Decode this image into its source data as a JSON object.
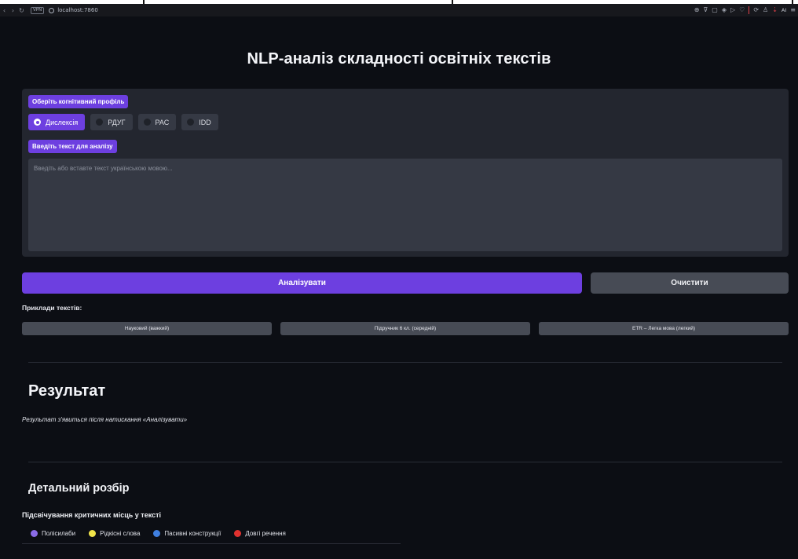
{
  "browser": {
    "url": "localhost:7860",
    "vpn_label": "VPN",
    "ai_label": "AI"
  },
  "page": {
    "title": "NLP-аналіз складності освітніх текстів"
  },
  "form": {
    "profile_label": "Оберіть когнітивний профіль",
    "profiles": [
      {
        "label": "Дислексія",
        "selected": true
      },
      {
        "label": "РДУГ",
        "selected": false
      },
      {
        "label": "РАС",
        "selected": false
      },
      {
        "label": "IDD",
        "selected": false
      }
    ],
    "text_label": "Введіть текст для аналізу",
    "text_placeholder": "Введіть або вставте текст українською мовою...",
    "text_value": ""
  },
  "actions": {
    "analyze_label": "Аналізувати",
    "clear_label": "Очистити"
  },
  "examples": {
    "label": "Приклади текстів:",
    "items": [
      "Науковий (важкий)",
      "Підручник 6 кл. (середній)",
      "ETR – Легка мова (легкий)"
    ]
  },
  "result": {
    "title": "Результат",
    "note": "Результат з'явиться після натискання «Аналізувати»"
  },
  "details": {
    "title": "Детальний розбір",
    "highlight_label": "Підсвічування критичних місць у тексті",
    "legend": [
      {
        "label": "Полісилаби",
        "color": "#8b6ce8"
      },
      {
        "label": "Рідкісні слова",
        "color": "#f1e44a"
      },
      {
        "label": "Пасивні конструкції",
        "color": "#3f7fe0"
      },
      {
        "label": "Довгі речення",
        "color": "#e0312f"
      }
    ]
  },
  "colors": {
    "accent": "#6d3fe0",
    "background": "#0c0e14",
    "panel": "#23262f",
    "secondary_button": "#474b55"
  }
}
